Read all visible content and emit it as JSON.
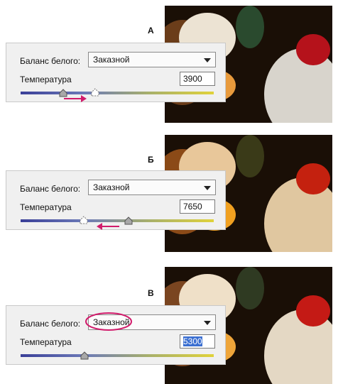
{
  "sections": [
    {
      "letter": "А",
      "white_balance_label": "Баланс белого:",
      "white_balance_value": "Заказной",
      "temperature_label": "Температура",
      "temperature_value": "3900",
      "slider_fraction": 0.22,
      "ghost_fraction": 0.39,
      "arrow_direction": "right"
    },
    {
      "letter": "Б",
      "white_balance_label": "Баланс белого:",
      "white_balance_value": "Заказной",
      "temperature_label": "Температура",
      "temperature_value": "7650",
      "slider_fraction": 0.56,
      "ghost_fraction": 0.33,
      "arrow_direction": "left"
    },
    {
      "letter": "В",
      "white_balance_label": "Баланс белого:",
      "white_balance_value": "Заказной",
      "temperature_label": "Температура",
      "temperature_value": "5300",
      "slider_fraction": 0.33,
      "highlight": "dropdown-circled"
    }
  ],
  "colors": {
    "annotation": "#d11b6b",
    "slider_start": "#3a3f98",
    "slider_end": "#e0d23a",
    "selection": "#3b6fd1"
  }
}
